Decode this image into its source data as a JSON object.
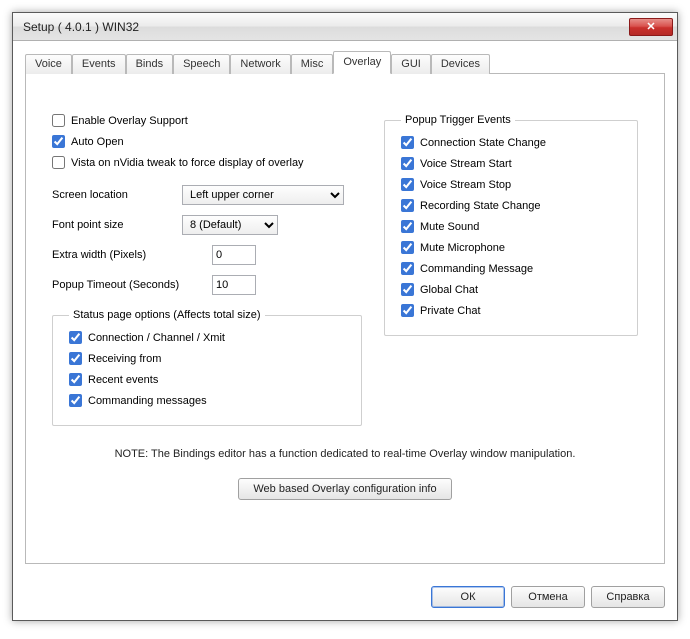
{
  "window": {
    "title": "Setup ( 4.0.1 ) WIN32"
  },
  "tabs": [
    {
      "label": "Voice"
    },
    {
      "label": "Events"
    },
    {
      "label": "Binds"
    },
    {
      "label": "Speech"
    },
    {
      "label": "Network"
    },
    {
      "label": "Misc"
    },
    {
      "label": "Overlay",
      "active": true
    },
    {
      "label": "GUI"
    },
    {
      "label": "Devices"
    }
  ],
  "overlay": {
    "enable_label": "Enable Overlay Support",
    "enable_checked": false,
    "auto_open_label": "Auto Open",
    "auto_open_checked": true,
    "vista_label": "Vista on nVidia tweak to force display of overlay",
    "vista_checked": false,
    "screen_location_label": "Screen location",
    "screen_location_value": "Left upper corner",
    "font_size_label": "Font point size",
    "font_size_value": "8 (Default)",
    "extra_width_label": "Extra width (Pixels)",
    "extra_width_value": "0",
    "popup_timeout_label": "Popup Timeout (Seconds)",
    "popup_timeout_value": "10",
    "status_legend": "Status page options (Affects total size)",
    "status_options": [
      {
        "label": "Connection / Channel / Xmit",
        "checked": true
      },
      {
        "label": "Receiving from",
        "checked": true
      },
      {
        "label": "Recent events",
        "checked": true
      },
      {
        "label": "Commanding messages",
        "checked": true
      }
    ],
    "trigger_legend": "Popup Trigger Events",
    "trigger_events": [
      {
        "label": "Connection State Change",
        "checked": true
      },
      {
        "label": "Voice Stream Start",
        "checked": true
      },
      {
        "label": "Voice Stream Stop",
        "checked": true
      },
      {
        "label": "Recording State Change",
        "checked": true
      },
      {
        "label": "Mute Sound",
        "checked": true
      },
      {
        "label": "Mute Microphone",
        "checked": true
      },
      {
        "label": "Commanding Message",
        "checked": true
      },
      {
        "label": "Global Chat",
        "checked": true
      },
      {
        "label": "Private Chat",
        "checked": true
      }
    ],
    "note": "NOTE: The Bindings editor has a function dedicated to real-time Overlay window manipulation.",
    "config_button": "Web based Overlay configuration info"
  },
  "buttons": {
    "ok": "ОК",
    "cancel": "Отмена",
    "help": "Справка"
  }
}
